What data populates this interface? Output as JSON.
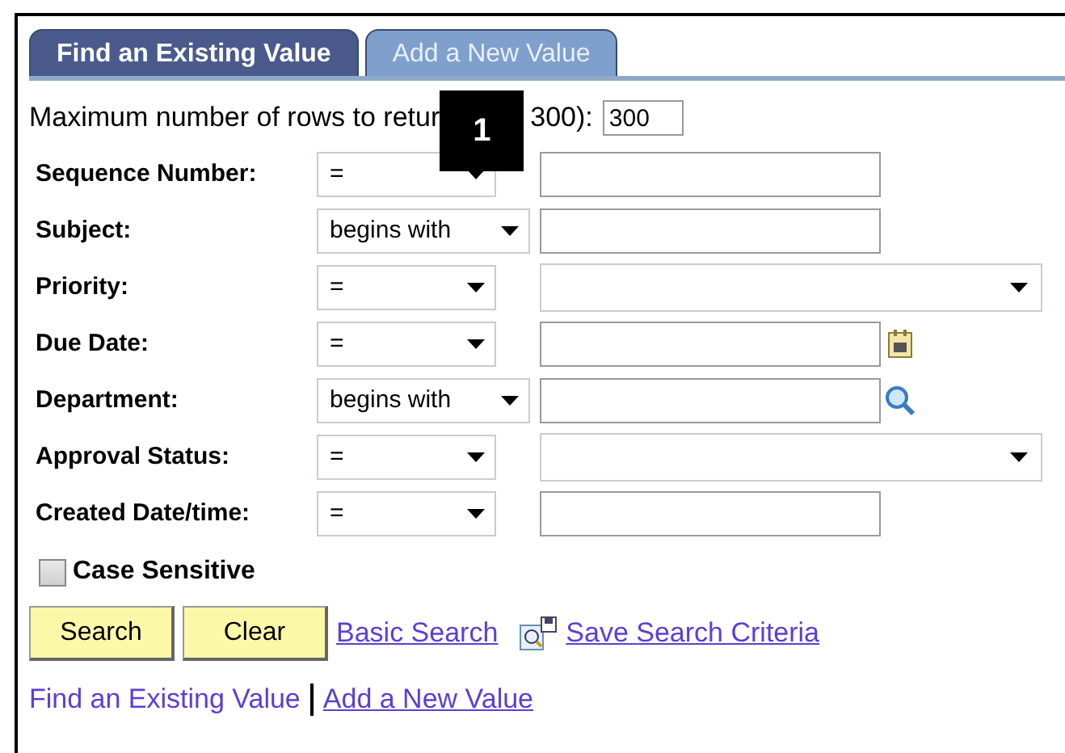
{
  "tabs": [
    {
      "label": "Find an Existing Value",
      "selected": true
    },
    {
      "label": "Add a New Value",
      "selected": false
    }
  ],
  "max_rows": {
    "label_before": "Maximum number of rows to retur",
    "label_after": "300):",
    "value": "300"
  },
  "callout": "1",
  "fields": [
    {
      "label": "Sequence Number:",
      "operator": "=",
      "kind": "text"
    },
    {
      "label": "Subject:",
      "operator": "begins with",
      "kind": "text"
    },
    {
      "label": "Priority:",
      "operator": "=",
      "kind": "dropdown"
    },
    {
      "label": "Due Date:",
      "operator": "=",
      "kind": "date"
    },
    {
      "label": "Department:",
      "operator": "begins with",
      "kind": "lookup"
    },
    {
      "label": "Approval Status:",
      "operator": "=",
      "kind": "dropdown"
    },
    {
      "label": "Created Date/time:",
      "operator": "=",
      "kind": "text"
    }
  ],
  "case_sensitive": {
    "label": "Case Sensitive",
    "checked": false
  },
  "buttons": [
    "Search",
    "Clear"
  ],
  "links": [
    "Basic Search",
    "Save Search Criteria"
  ],
  "footer_links": [
    {
      "label": "Find an Existing Value",
      "underlined": false
    },
    {
      "label": "Add a New Value",
      "underlined": true
    }
  ]
}
